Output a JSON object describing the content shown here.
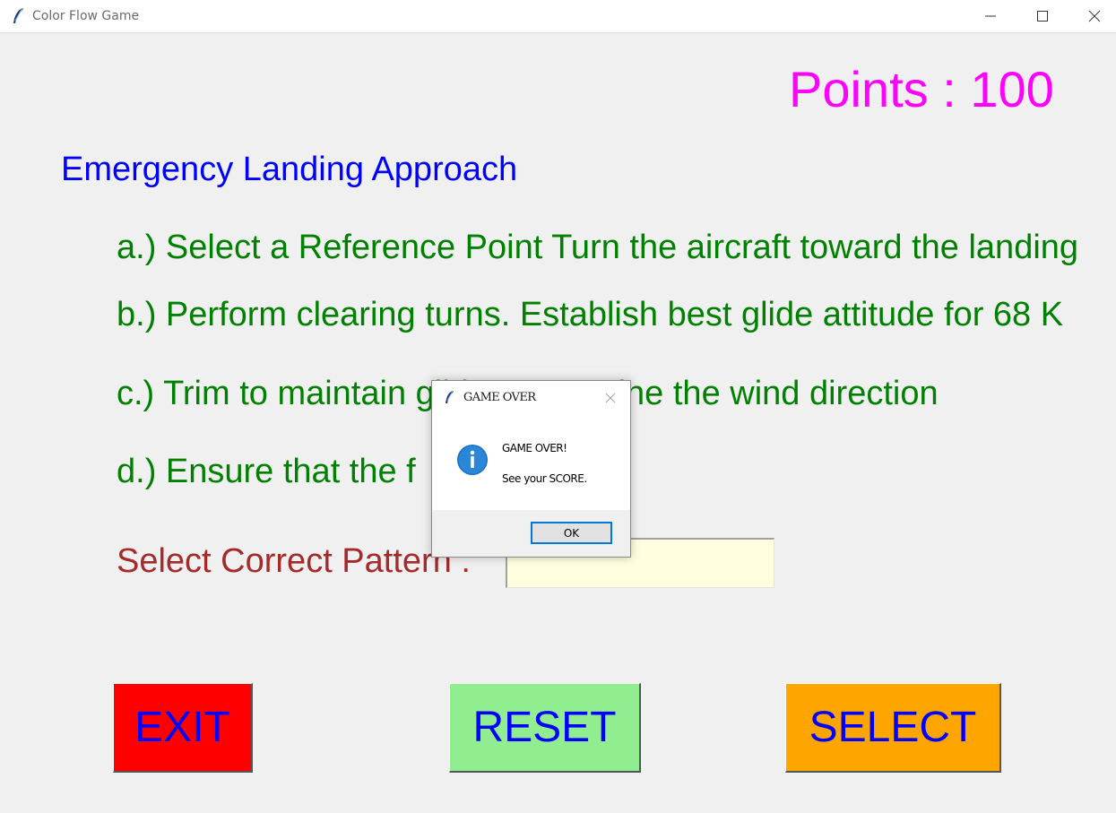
{
  "window": {
    "title": "Color Flow Game"
  },
  "game": {
    "points_text": "Points : 100",
    "heading": "Emergency Landing Approach",
    "steps": [
      "a.) Select a Reference Point Turn the aircraft toward the landing",
      "b.) Perform clearing turns. Establish best glide attitude for 68 K",
      "c.) Trim to maintain glide. Determine the wind direction",
      "d.) Ensure that the f"
    ],
    "pattern_label": "Select Correct Pattern :",
    "pattern_input_value": ""
  },
  "buttons": {
    "exit": "EXIT",
    "reset": "RESET",
    "select": "SELECT"
  },
  "dialog": {
    "title": "GAME OVER",
    "message_line1": "GAME OVER!",
    "message_line2": "See your SCORE.",
    "ok_label": "OK",
    "icon": "info-icon"
  },
  "colors": {
    "points": "#ff00ff",
    "heading": "#0000ff",
    "steps": "#008000",
    "pattern_label": "#a52a2a",
    "pattern_input_bg": "#ffffe0",
    "exit_bg": "#ff0000",
    "reset_bg": "#90ee90",
    "select_bg": "#ffa500",
    "button_text": "#0000ff"
  }
}
